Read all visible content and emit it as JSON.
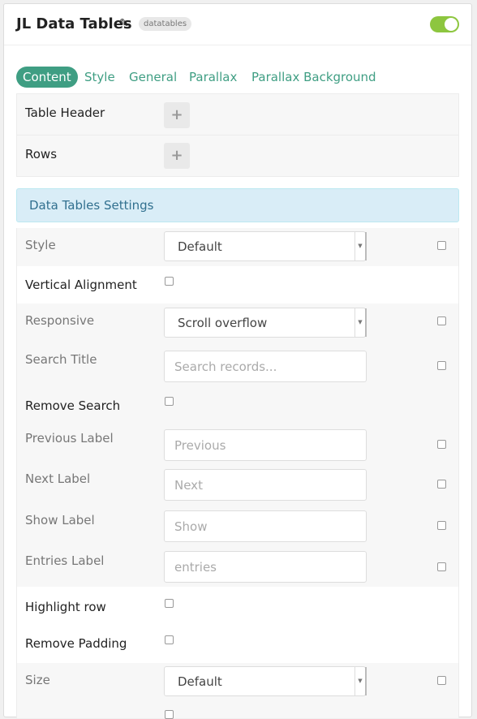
{
  "header": {
    "title": "JL Data Tables",
    "edit_icon": "pencil-icon",
    "tag": "datatables",
    "toggle_on": true
  },
  "tabs": [
    {
      "label": "Content",
      "active": true
    },
    {
      "label": "Style",
      "active": false
    },
    {
      "label": "General",
      "active": false
    },
    {
      "label": "Parallax",
      "active": false
    },
    {
      "label": "Parallax Background",
      "active": false
    }
  ],
  "content": {
    "table_header_label": "Table Header",
    "rows_label": "Rows",
    "add_icon": "plus-icon"
  },
  "settings_banner": "Data Tables Settings",
  "settings": {
    "style": {
      "label": "Style",
      "value": "Default"
    },
    "vertical_alignment": {
      "label": "Vertical Alignment"
    },
    "responsive": {
      "label": "Responsive",
      "value": "Scroll overflow"
    },
    "search_title": {
      "label": "Search Title",
      "placeholder": "Search records..."
    },
    "remove_search": {
      "label": "Remove Search"
    },
    "previous_label": {
      "label": "Previous Label",
      "placeholder": "Previous"
    },
    "next_label": {
      "label": "Next Label",
      "placeholder": "Next"
    },
    "show_label": {
      "label": "Show Label",
      "placeholder": "Show"
    },
    "entries_label": {
      "label": "Entries Label",
      "placeholder": "entries"
    },
    "highlight_row": {
      "label": "Highlight row"
    },
    "remove_padding": {
      "label": "Remove Padding"
    },
    "size": {
      "label": "Size",
      "value": "Default"
    }
  },
  "colors": {
    "accent": "#3f9e83",
    "toggle": "#8dc63f",
    "banner_bg": "#d9edf7",
    "banner_text": "#31708f"
  }
}
